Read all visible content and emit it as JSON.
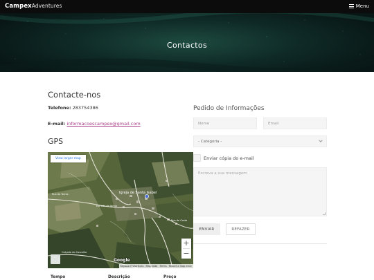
{
  "header": {
    "brand_bold": "Campex",
    "brand_rest": "Adventures",
    "menu_label": "Menu",
    "menu_icon": "hamburger-icon"
  },
  "hero": {
    "title": "Contactos"
  },
  "contact": {
    "heading": "Contacte-nos",
    "phone_label": "Telefone:",
    "phone_value": "283754386",
    "email_label": "E-mail:",
    "email_value": "informacoescampex@gmail.com",
    "gps_heading": "GPS"
  },
  "map": {
    "view_larger": "View larger map",
    "place_label": "Igreja de Santa Isabel",
    "road_label_1": "Rua do Torres",
    "road_label_2": "Estrada da Igreja",
    "road_label_3": "Rua de Costa",
    "road_label_4": "Calçada do Carvalho",
    "zoom_in": "+",
    "zoom_out": "−",
    "google": "Google",
    "attrib_1": "Keyboard shortcuts",
    "attrib_2": "Map Data",
    "attrib_3": "Terms",
    "attrib_4": "Report a map error"
  },
  "table": {
    "col_tempo": "Tempo",
    "col_descricao": "Descrição",
    "col_preco": "Preço"
  },
  "form": {
    "heading": "Pedido de Informações",
    "name_placeholder": "Nome",
    "email_placeholder": "Email",
    "category_selected": "- Categoria -",
    "copy_label": "Enviar cópia do e-mail",
    "message_placeholder": "Escreva a sua mensagem",
    "submit_label": "ENVIAR",
    "reset_label": "REFAZER"
  },
  "colors": {
    "topbar": "#0c0c0c",
    "hero_center": "#1d4a3f",
    "email_link": "#a83a86"
  }
}
